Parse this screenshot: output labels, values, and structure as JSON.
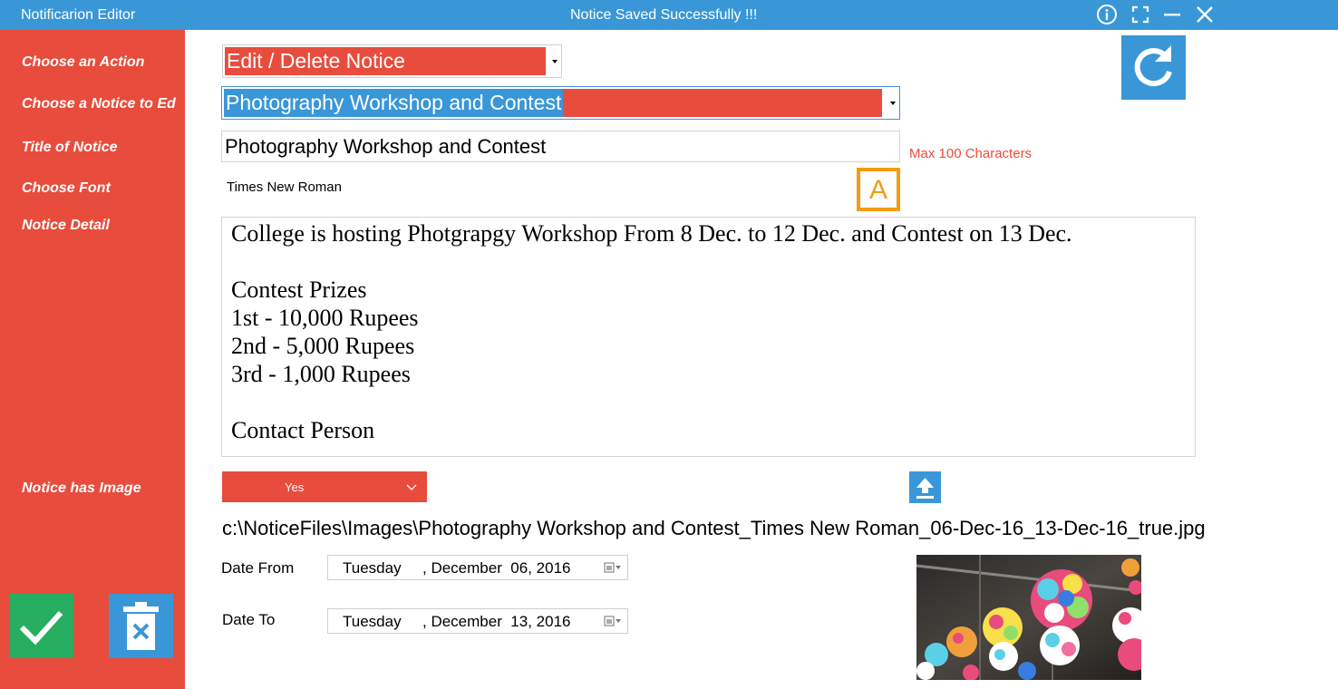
{
  "window": {
    "title": "Notificarion Editor",
    "status_message": "Notice Saved Successfully !!!"
  },
  "sidebar": {
    "labels": {
      "action": "Choose an Action",
      "notice_to_edit": "Choose a Notice to Ed",
      "title": "Title of Notice",
      "font": "Choose Font",
      "detail": "Notice Detail",
      "has_image": "Notice has Image"
    }
  },
  "form": {
    "action_value": "Edit / Delete Notice",
    "notice_select_value": "Photography Workshop and Contest",
    "title_value": "Photography Workshop and Contest",
    "title_hint": "Max 100 Characters",
    "font_value": "Times New Roman",
    "detail_lines": [
      "College is hosting Photgrapgy Workshop From 8 Dec. to 12 Dec. and Contest on 13 Dec.",
      "",
      "Contest Prizes",
      "1st - 10,000 Rupees",
      "2nd - 5,000 Rupees",
      "3rd - 1,000 Rupees",
      "",
      "Contact Person"
    ],
    "has_image_value": "Yes",
    "image_path": "c:\\NoticeFiles\\Images\\Photography Workshop and Contest_Times New Roman_06-Dec-16_13-Dec-16_true.jpg",
    "date_from": {
      "label": "Date From",
      "day": "Tuesday",
      "month_date": ", December  06, 2016"
    },
    "date_to": {
      "label": "Date To",
      "day": "Tuesday",
      "month_date": ", December  13, 2016"
    },
    "font_button_letter": "A"
  },
  "colors": {
    "titlebar": "#3a97d7",
    "accent_red": "#e84c3d",
    "confirm_green": "#27ae60",
    "button_blue": "#3a97d7",
    "font_button_orange": "#f39c12"
  },
  "icons": {
    "info": "info-icon",
    "maximize": "maximize-icon",
    "minimize": "minimize-icon",
    "close": "close-icon",
    "refresh": "refresh-icon",
    "font": "font-icon",
    "upload": "upload-icon",
    "calendar": "calendar-icon",
    "confirm": "checkmark-icon",
    "delete": "trash-icon"
  }
}
